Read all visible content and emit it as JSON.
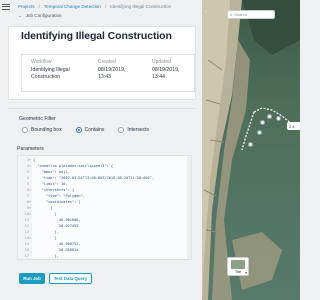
{
  "breadcrumbs": {
    "items": [
      "Projects",
      "Temporal Change Detection",
      "Identifying Illegal Construction"
    ],
    "back_label": "Job Configuration"
  },
  "job": {
    "title": "Identifying Illegal Construction",
    "workflow_label": "Workflow",
    "workflow_value_line1": "Identifying Illegal",
    "workflow_value_line2": "Construction",
    "created_label": "Created",
    "created_date": "08/19/2019,",
    "created_time": "13:43",
    "updated_label": "Updated",
    "updated_date": "08/19/2019,",
    "updated_time": "13:44"
  },
  "geometric_filter": {
    "label": "Geometric Filter",
    "options": [
      "Bounding box",
      "Contains",
      "Intersects"
    ],
    "selected": "Contains"
  },
  "parameters": {
    "label": "Parameters",
    "lines": [
      {
        "n": "1",
        "fold": "▾",
        "text": "{"
      },
      {
        "n": "2",
        "fold": "▾",
        "text": "  \"oneatlas-pleiades-aoiclipped:1\": {"
      },
      {
        "n": "3",
        "fold": "",
        "text": "    \"bbox\": null,"
      },
      {
        "n": "4",
        "fold": "",
        "text": "    \"time\": \"2007-03-01T13:00:00Z/2018-08-20T11:28:00Z\","
      },
      {
        "n": "5",
        "fold": "",
        "text": "    \"limit\": 10,"
      },
      {
        "n": "6",
        "fold": "▾",
        "text": "    \"intersects\": {"
      },
      {
        "n": "7",
        "fold": "",
        "text": "      \"type\": \"Polygon\","
      },
      {
        "n": "8",
        "fold": "▾",
        "text": "      \"coordinates\": ["
      },
      {
        "n": "9",
        "fold": "▾",
        "text": "        ["
      },
      {
        "n": "10",
        "fold": "▾",
        "text": "          ["
      },
      {
        "n": "11",
        "fold": "",
        "text": "            46.901606,"
      },
      {
        "n": "12",
        "fold": "",
        "text": "            26.027493"
      },
      {
        "n": "13",
        "fold": "",
        "text": "          ],"
      },
      {
        "n": "14",
        "fold": "▾",
        "text": "          ["
      },
      {
        "n": "15",
        "fold": "",
        "text": "            46.900752,"
      },
      {
        "n": "16",
        "fold": "",
        "text": "            26.016814"
      },
      {
        "n": "17",
        "fold": "",
        "text": "          ],"
      }
    ]
  },
  "actions": {
    "run_label": "Run Job",
    "test_label": "Test Data Query"
  },
  "map": {
    "search_placeholder": "Search",
    "expand_icon": "chevron-left-icon",
    "scale_text": "2.4",
    "tile_label": "Tile",
    "tile_chevron": "chevron-down-icon"
  },
  "colors": {
    "accent": "#1a9cc0",
    "link": "#2a7fbd",
    "radio_selected": "#2e6fd8"
  }
}
